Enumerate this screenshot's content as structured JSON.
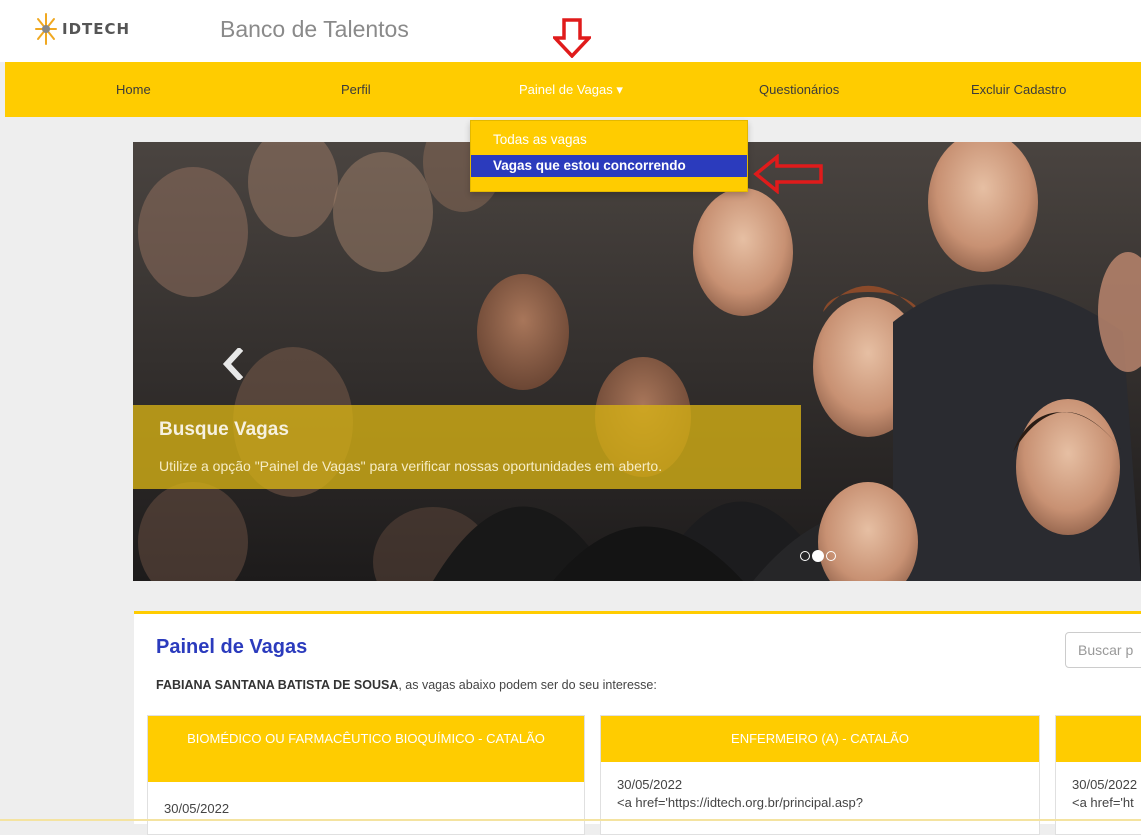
{
  "header": {
    "logo_text": "IDTECH",
    "site_title": "Banco de Talentos"
  },
  "nav": {
    "items": [
      {
        "label": "Home"
      },
      {
        "label": "Perfil"
      },
      {
        "label": "Painel de Vagas ▾"
      },
      {
        "label": "Questionários"
      },
      {
        "label": "Excluir Cadastro"
      }
    ],
    "dropdown": [
      {
        "label": "Todas as vagas"
      },
      {
        "label": "Vagas que estou concorrendo"
      }
    ]
  },
  "carousel": {
    "caption_title": "Busque Vagas",
    "caption_text": "Utilize a opção \"Painel de Vagas\" para verificar nossas oportunidades em aberto.",
    "active_slide": 2,
    "slide_count": 3
  },
  "panel": {
    "title": "Painel de Vagas",
    "user_name": "FABIANA SANTANA BATISTA DE SOUSA",
    "subtitle_rest": ", as vagas abaixo podem ser do seu interesse:",
    "search_placeholder": "Buscar p"
  },
  "jobs": [
    {
      "title": "BIOMÉDICO OU FARMACÊUTICO BIOQUÍMICO - CATALÃO",
      "date": "30/05/2022",
      "link_text": ""
    },
    {
      "title": "ENFERMEIRO (A) - CATALÃO",
      "date": "30/05/2022",
      "link_text": "<a href='https://idtech.org.br/principal.asp?"
    },
    {
      "title": "",
      "date": "30/05/2022",
      "link_text": "<a href='ht"
    }
  ],
  "colors": {
    "accent": "#ffcc00",
    "highlight": "#2b3bbd",
    "annotation_arrow": "#e01b1b"
  }
}
